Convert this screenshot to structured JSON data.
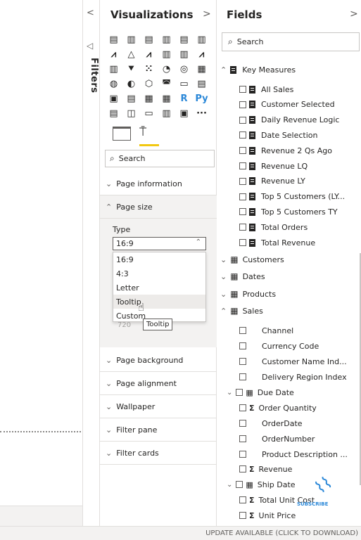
{
  "filters": {
    "label": "Filters"
  },
  "viz": {
    "title": "Visualizations",
    "collapse_glyph": "<",
    "expand_glyph": ">",
    "search_placeholder": "Search",
    "icons": [
      [
        "▤",
        "▥",
        "▤",
        "▥",
        "▤",
        "▥"
      ],
      [
        "⩘",
        "△",
        "⩘",
        "▥",
        "▥",
        "⩘"
      ],
      [
        "▥",
        "⯆",
        "⁙",
        "◔",
        "◎",
        "▦"
      ],
      [
        "◍",
        "◐",
        "⬡",
        "◚",
        "▭",
        "▤"
      ],
      [
        "▣",
        "▤",
        "▦",
        "▦",
        "R",
        "Py"
      ],
      [
        "▤",
        "◫",
        "▭",
        "▥",
        "▣",
        "···"
      ]
    ],
    "sections": {
      "page_information": "Page information",
      "page_size": "Page size",
      "page_background": "Page background",
      "page_alignment": "Page alignment",
      "wallpaper": "Wallpaper",
      "filter_pane": "Filter pane",
      "filter_cards": "Filter cards"
    },
    "type_label": "Type",
    "type_selected": "16:9",
    "type_options": [
      "16:9",
      "4:3",
      "Letter",
      "Tooltip",
      "Custom"
    ],
    "height_value": "720",
    "tooltip": "Tooltip"
  },
  "fields": {
    "title": "Fields",
    "expand_glyph": ">",
    "search_placeholder": "Search",
    "groups": {
      "key_measures": "Key Measures",
      "customers": "Customers",
      "dates": "Dates",
      "products": "Products",
      "sales": "Sales"
    },
    "measures": [
      "All Sales",
      "Customer Selected",
      "Daily Revenue Logic",
      "Date Selection",
      "Revenue 2 Qs Ago",
      "Revenue LQ",
      "Revenue LY",
      "Top 5 Customers (LY...",
      "Top 5 Customers TY",
      "Total Orders",
      "Total Revenue"
    ],
    "sales_fields": {
      "channel": "Channel",
      "currency_code": "Currency Code",
      "customer_name_ind": "Customer Name Ind...",
      "delivery_region_index": "Delivery Region Index",
      "due_date": "Due Date",
      "order_quantity": "Order Quantity",
      "order_date": "OrderDate",
      "order_number": "OrderNumber",
      "product_description": "Product Description ...",
      "revenue": "Revenue",
      "ship_date": "Ship Date",
      "total_unit_cost": "Total Unit Cost",
      "unit_price": "Unit Price"
    },
    "subscribe": "SUBSCRIBE"
  },
  "status": {
    "update_text": "UPDATE AVAILABLE (CLICK TO DOWNLOAD)"
  },
  "colors": {
    "accent": "#f2c811",
    "border": "#e1dfdd",
    "panel": "#f3f2f1",
    "logo": "#2b88d8"
  }
}
